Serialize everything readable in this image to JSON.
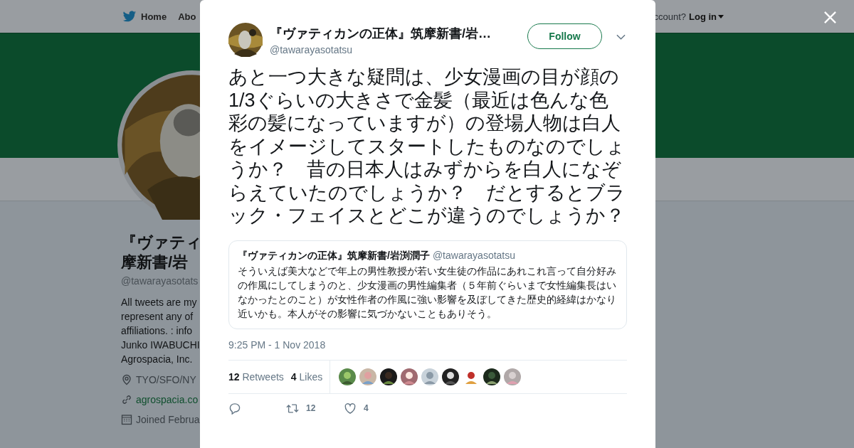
{
  "nav": {
    "items": [
      {
        "kind": "home",
        "label": "Home"
      },
      {
        "kind": "plain",
        "label": "Abo"
      }
    ],
    "account_prompt": "ccount?",
    "login": "Log in"
  },
  "profile": {
    "name_lines": [
      "『ヴァティ",
      "摩新書/岩"
    ],
    "handle": "@tawarayasotats",
    "bio_lines": [
      "All tweets are my",
      "represent any of",
      "affiliations. : info",
      "Junko IWABUCHI",
      "Agrospacia, Inc."
    ],
    "location": "TYO/SFO/NY",
    "website": "agrospacia.co",
    "joined": "Joined Februa"
  },
  "tweet": {
    "author": {
      "name": "『ヴァティカンの正体』筑摩新書/岩…",
      "handle": "@tawarayasotatsu"
    },
    "follow_button": "Follow",
    "text": "あと一つ大きな疑問は、少女漫画の目が顔の1/3ぐらいの大きさで金髪（最近は色んな色彩の髪になっていますが）の登場人物は白人をイメージしてスタートしたものなのでしょうか？　昔の日本人はみずからを白人になぞらえていたのでしょうか？　だとするとブラック・フェイスとどこが違うのでしょうか？",
    "quote": {
      "name": "『ヴァティカンの正体』筑摩新書/岩渕潤子",
      "handle": "@tawarayasotatsu",
      "text": "そういえば美大などで年上の男性教授が若い女生徒の作品にあれこれ言って自分好みの作風にしてしまうのと、少女漫画の男性編集者（５年前ぐらいまで女性編集長はいなかったとのこと）が女性作者の作風に強い影響を及ぼしてきた歴史的経緯はかなり近いかも。本人がその影響に気づかないこともありそう。"
    },
    "timestamp": "9:25 PM - 1 Nov 2018",
    "retweets": {
      "count": "12",
      "label": "Retweets"
    },
    "likes": {
      "count": "4",
      "label": "Likes"
    },
    "actions": [
      {
        "kind": "reply"
      },
      {
        "kind": "retweet",
        "count": "12"
      },
      {
        "kind": "like",
        "count": "4"
      }
    ]
  }
}
